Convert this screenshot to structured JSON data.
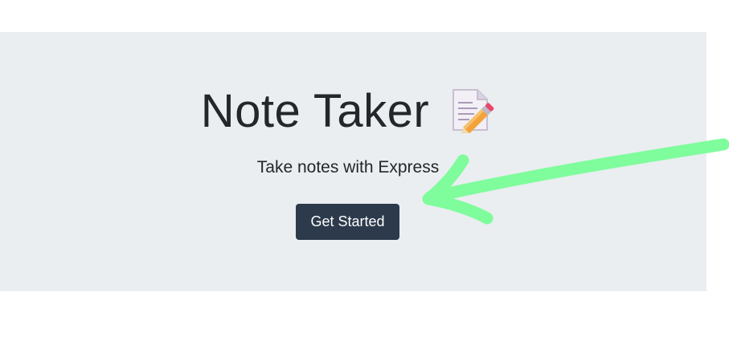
{
  "hero": {
    "title": "Note Taker",
    "subtitle": "Take notes with Express",
    "button_label": "Get Started",
    "title_icon": "memo-pencil-icon"
  },
  "annotation": {
    "arrow_color": "#7ffc9c",
    "arrow_icon": "hand-drawn-arrow-annotation"
  },
  "colors": {
    "jumbotron_bg": "#eaeef0",
    "button_bg": "#2c3a4c",
    "text": "#23272b"
  }
}
